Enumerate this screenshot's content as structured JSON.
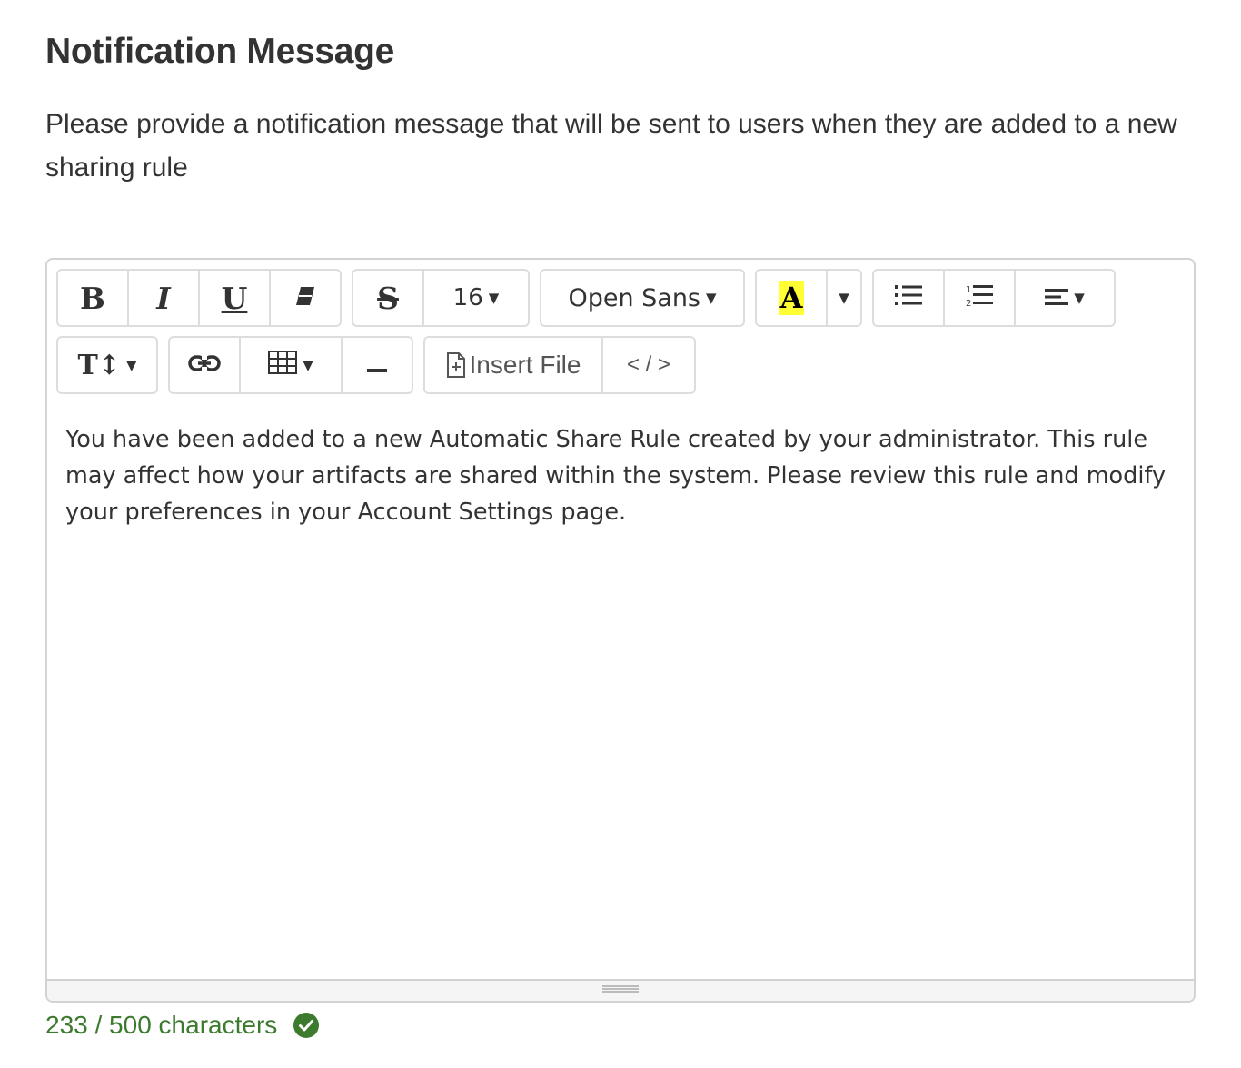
{
  "page": {
    "title": "Notification Message",
    "description": "Please provide a notification message that will be sent to users when they are added to a new sharing rule"
  },
  "toolbar": {
    "bold": "B",
    "italic": "I",
    "underline": "U",
    "strikethrough": "S",
    "font_size": "16",
    "font_family": "Open Sans",
    "color_letter": "A",
    "line_height": "T↕",
    "insert_file": "Insert File",
    "code_view": "< / >",
    "highlight_color": "#ffff33",
    "icons": [
      "bold-icon",
      "italic-icon",
      "underline-icon",
      "eraser-icon",
      "strikethrough-icon",
      "text-color-icon",
      "unordered-list-icon",
      "ordered-list-icon",
      "align-icon",
      "line-height-icon",
      "link-icon",
      "table-icon",
      "horizontal-rule-icon",
      "file-icon",
      "code-icon"
    ]
  },
  "editor": {
    "content": "You have been added to a new Automatic Share Rule created by your administrator. This rule may affect how your artifacts are shared within the system. Please review this rule and modify your preferences in your Account Settings page."
  },
  "footer": {
    "char_count": "233 / 500 characters",
    "status_color": "#3c7a2e"
  }
}
